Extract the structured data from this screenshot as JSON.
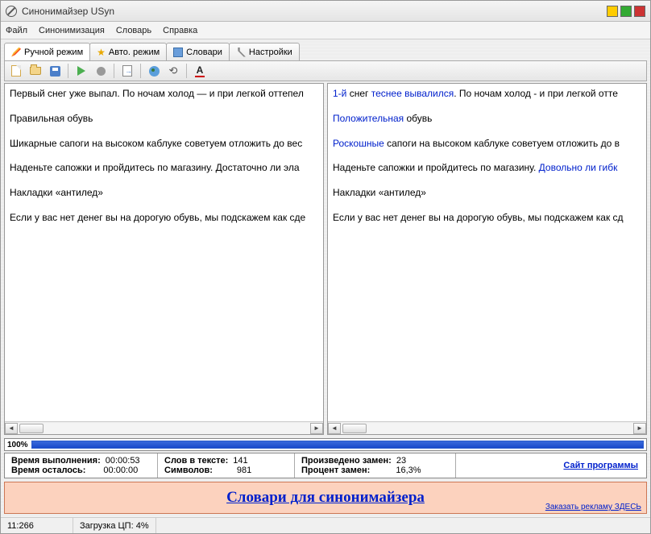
{
  "window": {
    "title": "Синонимайзер USyn"
  },
  "menu": {
    "file": "Файл",
    "synon": "Синонимизация",
    "dict": "Словарь",
    "help": "Справка"
  },
  "tabs": {
    "manual": "Ручной режим",
    "auto": "Авто. режим",
    "dicts": "Словари",
    "settings": "Настройки"
  },
  "toolbar_icons": {
    "font_letter": "A"
  },
  "left_text": {
    "p1": "Первый снег уже выпал. По ночам холод — и при легкой оттепел",
    "p2": "Правильная обувь",
    "p3": "Шикарные сапоги на высоком каблуке советуем отложить до вес",
    "p4": "Наденьте сапожки и пройдитесь по магазину. Достаточно ли эла",
    "p5": "Накладки «антилед»",
    "p6": "Если у вас нет денег вы на дорогую обувь, мы подскажем как сде"
  },
  "right_text": {
    "p1a": "1-й",
    "p1b": " снег ",
    "p1c": "теснее вывалился",
    "p1d": ". По ночам холод - и при легкой отте",
    "p2a": "Положительная",
    "p2b": " обувь",
    "p3a": "Роскошные",
    "p3b": " сапоги на высоком каблуке советуем отложить до в",
    "p4a": "Наденьте сапожки и пройдитесь по магазину. ",
    "p4b": "Довольно ли гибк",
    "p5": "Накладки «антилед»",
    "p6": "Если у вас нет денег вы на дорогую обувь, мы подскажем как сд"
  },
  "progress": {
    "label": "100%"
  },
  "stats": {
    "time_exec_label": "Время выполнения:",
    "time_exec_val": "00:00:53",
    "time_left_label": "Время осталось:",
    "time_left_val": "00:00:00",
    "words_label": "Слов в тексте:",
    "words_val": "141",
    "chars_label": "Символов:",
    "chars_val": "981",
    "repl_label": "Произведено замен:",
    "repl_val": "23",
    "pct_label": "Процент замен:",
    "pct_val": "16,3%",
    "site_link": "Сайт программы"
  },
  "banner": {
    "main": "Словари для синонимайзера",
    "small": "Заказать рекламу ЗДЕСЬ"
  },
  "status": {
    "pos": "11:266",
    "cpu": "Загрузка ЦП: 4%"
  }
}
